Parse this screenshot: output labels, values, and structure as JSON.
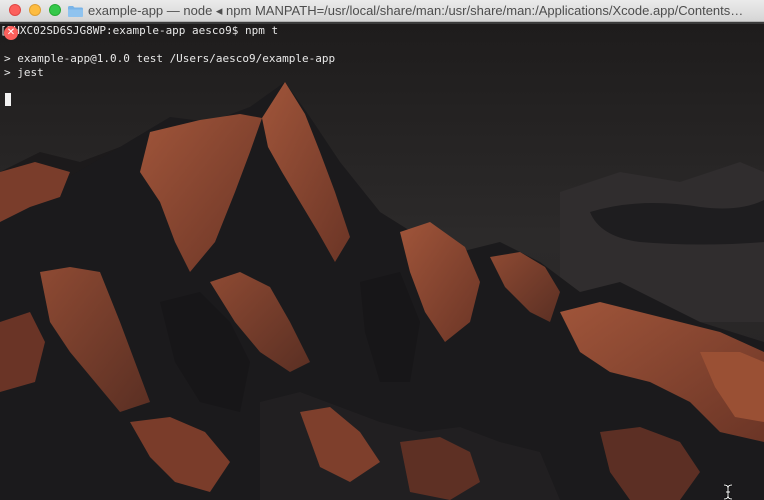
{
  "window": {
    "title": "example-app — node ◂ npm MANPATH=/usr/local/share/man:/usr/share/man:/Applications/Xcode.app/Contents…"
  },
  "terminal": {
    "prompt": "[PHXC02SD6SJG8WP:example-app aesco9$ npm t",
    "output": [
      "> example-app@1.0.0 test /Users/aesco9/example-app",
      "> jest"
    ]
  },
  "colors": {
    "text": "#e8e8e8",
    "close": "#fc605c",
    "minimize": "#fdbc40",
    "zoom": "#34c84a"
  }
}
